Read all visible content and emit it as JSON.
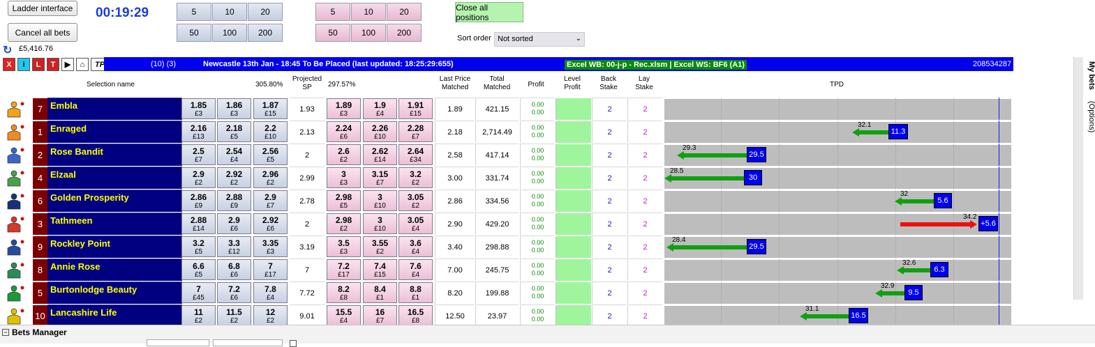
{
  "header": {
    "ladder_btn": "Ladder interface",
    "cancel_btn": "Cancel all bets",
    "clock": "00:19:29",
    "balance": "£5,416.76",
    "back_stakes": [
      "5",
      "10",
      "20",
      "50",
      "100",
      "200"
    ],
    "lay_stakes": [
      "5",
      "10",
      "20",
      "50",
      "100",
      "200"
    ],
    "close_all": "Close all positions",
    "sort_label": "Sort order",
    "sort_value": "Not sorted"
  },
  "toolbar": {
    "x": "X",
    "i": "i",
    "l": "L",
    "t": "T",
    "tpd": "TPD"
  },
  "market": {
    "counts": "(10) (3)",
    "title": "Newcastle 13th Jan - 18:45 To Be Placed (last updated: 18:25:29:655)",
    "excel": "Excel WB: 00-j-p - Rec.xlsm | Excel WS: BF6 (A1)",
    "market_id": "208534287"
  },
  "columns": {
    "selection": "Selection name",
    "back_book": "305.80%",
    "proj_sp": "Projected SP",
    "lay_book": "297.57%",
    "last_price": "Last Price Matched",
    "total": "Total Matched",
    "profit": "Profit",
    "level": "Level Profit",
    "back_stake": "Back Stake",
    "lay_stake": "Lay Stake",
    "tpd": "TPD"
  },
  "side_tabs": {
    "bets": "My bets",
    "options": "(Options)"
  },
  "bottom": {
    "title": "Bets Manager"
  },
  "runners": [
    {
      "num": "7",
      "name": "Embla",
      "back": [
        [
          "1.85",
          "£3"
        ],
        [
          "1.86",
          "£3"
        ],
        [
          "1.87",
          "£15"
        ]
      ],
      "sp": "1.93",
      "lay": [
        [
          "1.89",
          "£3"
        ],
        [
          "1.9",
          "£4"
        ],
        [
          "1.91",
          "£15"
        ]
      ],
      "last": "1.89",
      "total": "421.15",
      "p1": "0.00",
      "p2": "0.00",
      "bs": "2",
      "ls": "2",
      "tpd": null,
      "silk": "#f2a21b"
    },
    {
      "num": "1",
      "name": "Enraged",
      "back": [
        [
          "2.16",
          "£13"
        ],
        [
          "2.18",
          "£5"
        ],
        [
          "2.2",
          "£10"
        ]
      ],
      "sp": "2.13",
      "lay": [
        [
          "2.24",
          "£6"
        ],
        [
          "2.26",
          "£10"
        ],
        [
          "2.28",
          "£7"
        ]
      ],
      "last": "2.18",
      "total": "2,714.49",
      "p1": "0.00",
      "p2": "0.00",
      "bs": "2",
      "ls": "2",
      "tpd": {
        "label": "32.1",
        "box": "11.3",
        "color": "#10a010",
        "dir": "left",
        "start": 1221,
        "end": 1273
      },
      "silk": "#f08a22"
    },
    {
      "num": "2",
      "name": "Rose Bandit",
      "back": [
        [
          "2.5",
          "£7"
        ],
        [
          "2.54",
          "£4"
        ],
        [
          "2.56",
          "£5"
        ]
      ],
      "sp": "2",
      "lay": [
        [
          "2.6",
          "£2"
        ],
        [
          "2.62",
          "£14"
        ],
        [
          "2.64",
          "£34"
        ]
      ],
      "last": "2.58",
      "total": "417.14",
      "p1": "0.00",
      "p2": "0.00",
      "bs": "2",
      "ls": "2",
      "tpd": {
        "label": "29.3",
        "box": "29.5",
        "color": "#10a010",
        "dir": "left",
        "start": 970,
        "end": 1070
      },
      "silk": "#3a66c8"
    },
    {
      "num": "4",
      "name": "Elzaal",
      "back": [
        [
          "2.9",
          "£2"
        ],
        [
          "2.92",
          "£2"
        ],
        [
          "2.96",
          "£2"
        ]
      ],
      "sp": "2.99",
      "lay": [
        [
          "3",
          "£3"
        ],
        [
          "3.15",
          "£7"
        ],
        [
          "3.2",
          "£2"
        ]
      ],
      "last": "3.00",
      "total": "331.74",
      "p1": "0.00",
      "p2": "0.00",
      "bs": "2",
      "ls": "2",
      "tpd": {
        "label": "28.5",
        "box": "30",
        "color": "#10a010",
        "dir": "left",
        "start": 952,
        "end": 1066
      },
      "silk": "#4aa04a"
    },
    {
      "num": "6",
      "name": "Golden Prosperity",
      "back": [
        [
          "2.86",
          "£9"
        ],
        [
          "2.88",
          "£9"
        ],
        [
          "2.9",
          "£7"
        ]
      ],
      "sp": "2.78",
      "lay": [
        [
          "2.98",
          "£5"
        ],
        [
          "3",
          "£10"
        ],
        [
          "3.05",
          "£2"
        ]
      ],
      "last": "2.86",
      "total": "334.56",
      "p1": "0.00",
      "p2": "0.00",
      "bs": "2",
      "ls": "2",
      "tpd": {
        "label": "32",
        "box": "5.6",
        "color": "#10a010",
        "dir": "left",
        "start": 1282,
        "end": 1338
      },
      "silk": "#1a2f7a"
    },
    {
      "num": "3",
      "name": "Tathmeen",
      "back": [
        [
          "2.88",
          "£14"
        ],
        [
          "2.9",
          "£6"
        ],
        [
          "2.92",
          "£6"
        ]
      ],
      "sp": "2",
      "lay": [
        [
          "2.98",
          "£2"
        ],
        [
          "3",
          "£10"
        ],
        [
          "3.05",
          "£4"
        ]
      ],
      "last": "2.90",
      "total": "429.20",
      "p1": "0.00",
      "p2": "0.00",
      "bs": "2",
      "ls": "2",
      "tpd": {
        "label": "34.2",
        "box": "+5.6",
        "color": "#ee1010",
        "dir": "right",
        "start": 1290,
        "end": 1400
      },
      "silk": "#d23a2a"
    },
    {
      "num": "9",
      "name": "Rockley Point",
      "back": [
        [
          "3.2",
          "£5"
        ],
        [
          "3.3",
          "£12"
        ],
        [
          "3.35",
          "£3"
        ]
      ],
      "sp": "3.19",
      "lay": [
        [
          "3.5",
          "£3"
        ],
        [
          "3.55",
          "£2"
        ],
        [
          "3.6",
          "£4"
        ]
      ],
      "last": "3.40",
      "total": "298.88",
      "p1": "0.00",
      "p2": "0.00",
      "bs": "2",
      "ls": "2",
      "tpd": {
        "label": "28.4",
        "box": "29.5",
        "color": "#10a010",
        "dir": "left",
        "start": 955,
        "end": 1070
      },
      "silk": "#2a4aa0"
    },
    {
      "num": "8",
      "name": "Annie Rose",
      "back": [
        [
          "6.6",
          "£5"
        ],
        [
          "6.8",
          "£6"
        ],
        [
          "7",
          "£17"
        ]
      ],
      "sp": "7",
      "lay": [
        [
          "7.2",
          "£17"
        ],
        [
          "7.4",
          "£15"
        ],
        [
          "7.6",
          "£4"
        ]
      ],
      "last": "7.00",
      "total": "245.75",
      "p1": "0.00",
      "p2": "0.00",
      "bs": "2",
      "ls": "2",
      "tpd": {
        "label": "32.6",
        "box": "6.3",
        "color": "#10a010",
        "dir": "left",
        "start": 1285,
        "end": 1333
      },
      "silk": "#2a8a5a"
    },
    {
      "num": "5",
      "name": "Burtonlodge Beauty",
      "back": [
        [
          "7",
          "£45"
        ],
        [
          "7.2",
          "£6"
        ],
        [
          "7.8",
          "£4"
        ]
      ],
      "sp": "7.72",
      "lay": [
        [
          "8.2",
          "£8"
        ],
        [
          "8.4",
          "£1"
        ],
        [
          "8.8",
          "£1"
        ]
      ],
      "last": "8.20",
      "total": "199.88",
      "p1": "0.00",
      "p2": "0.00",
      "bs": "2",
      "ls": "2",
      "tpd": {
        "label": "32.9",
        "box": "9.5",
        "color": "#10a010",
        "dir": "left",
        "start": 1254,
        "end": 1296
      },
      "silk": "#1a9a3a"
    },
    {
      "num": "10",
      "name": "Lancashire Life",
      "back": [
        [
          "11",
          "£2"
        ],
        [
          "11.5",
          "£2"
        ],
        [
          "12",
          "£2"
        ]
      ],
      "sp": "9.01",
      "lay": [
        [
          "15.5",
          "£4"
        ],
        [
          "16",
          "£7"
        ],
        [
          "16.5",
          "£8"
        ]
      ],
      "last": "12.50",
      "total": "23.97",
      "p1": "0.00",
      "p2": "0.00",
      "bs": "2",
      "ls": "2",
      "tpd": {
        "label": "31.1",
        "box": "16.5",
        "color": "#10a010",
        "dir": "left",
        "start": 1146,
        "end": 1216
      },
      "silk": "#e0c000"
    }
  ]
}
